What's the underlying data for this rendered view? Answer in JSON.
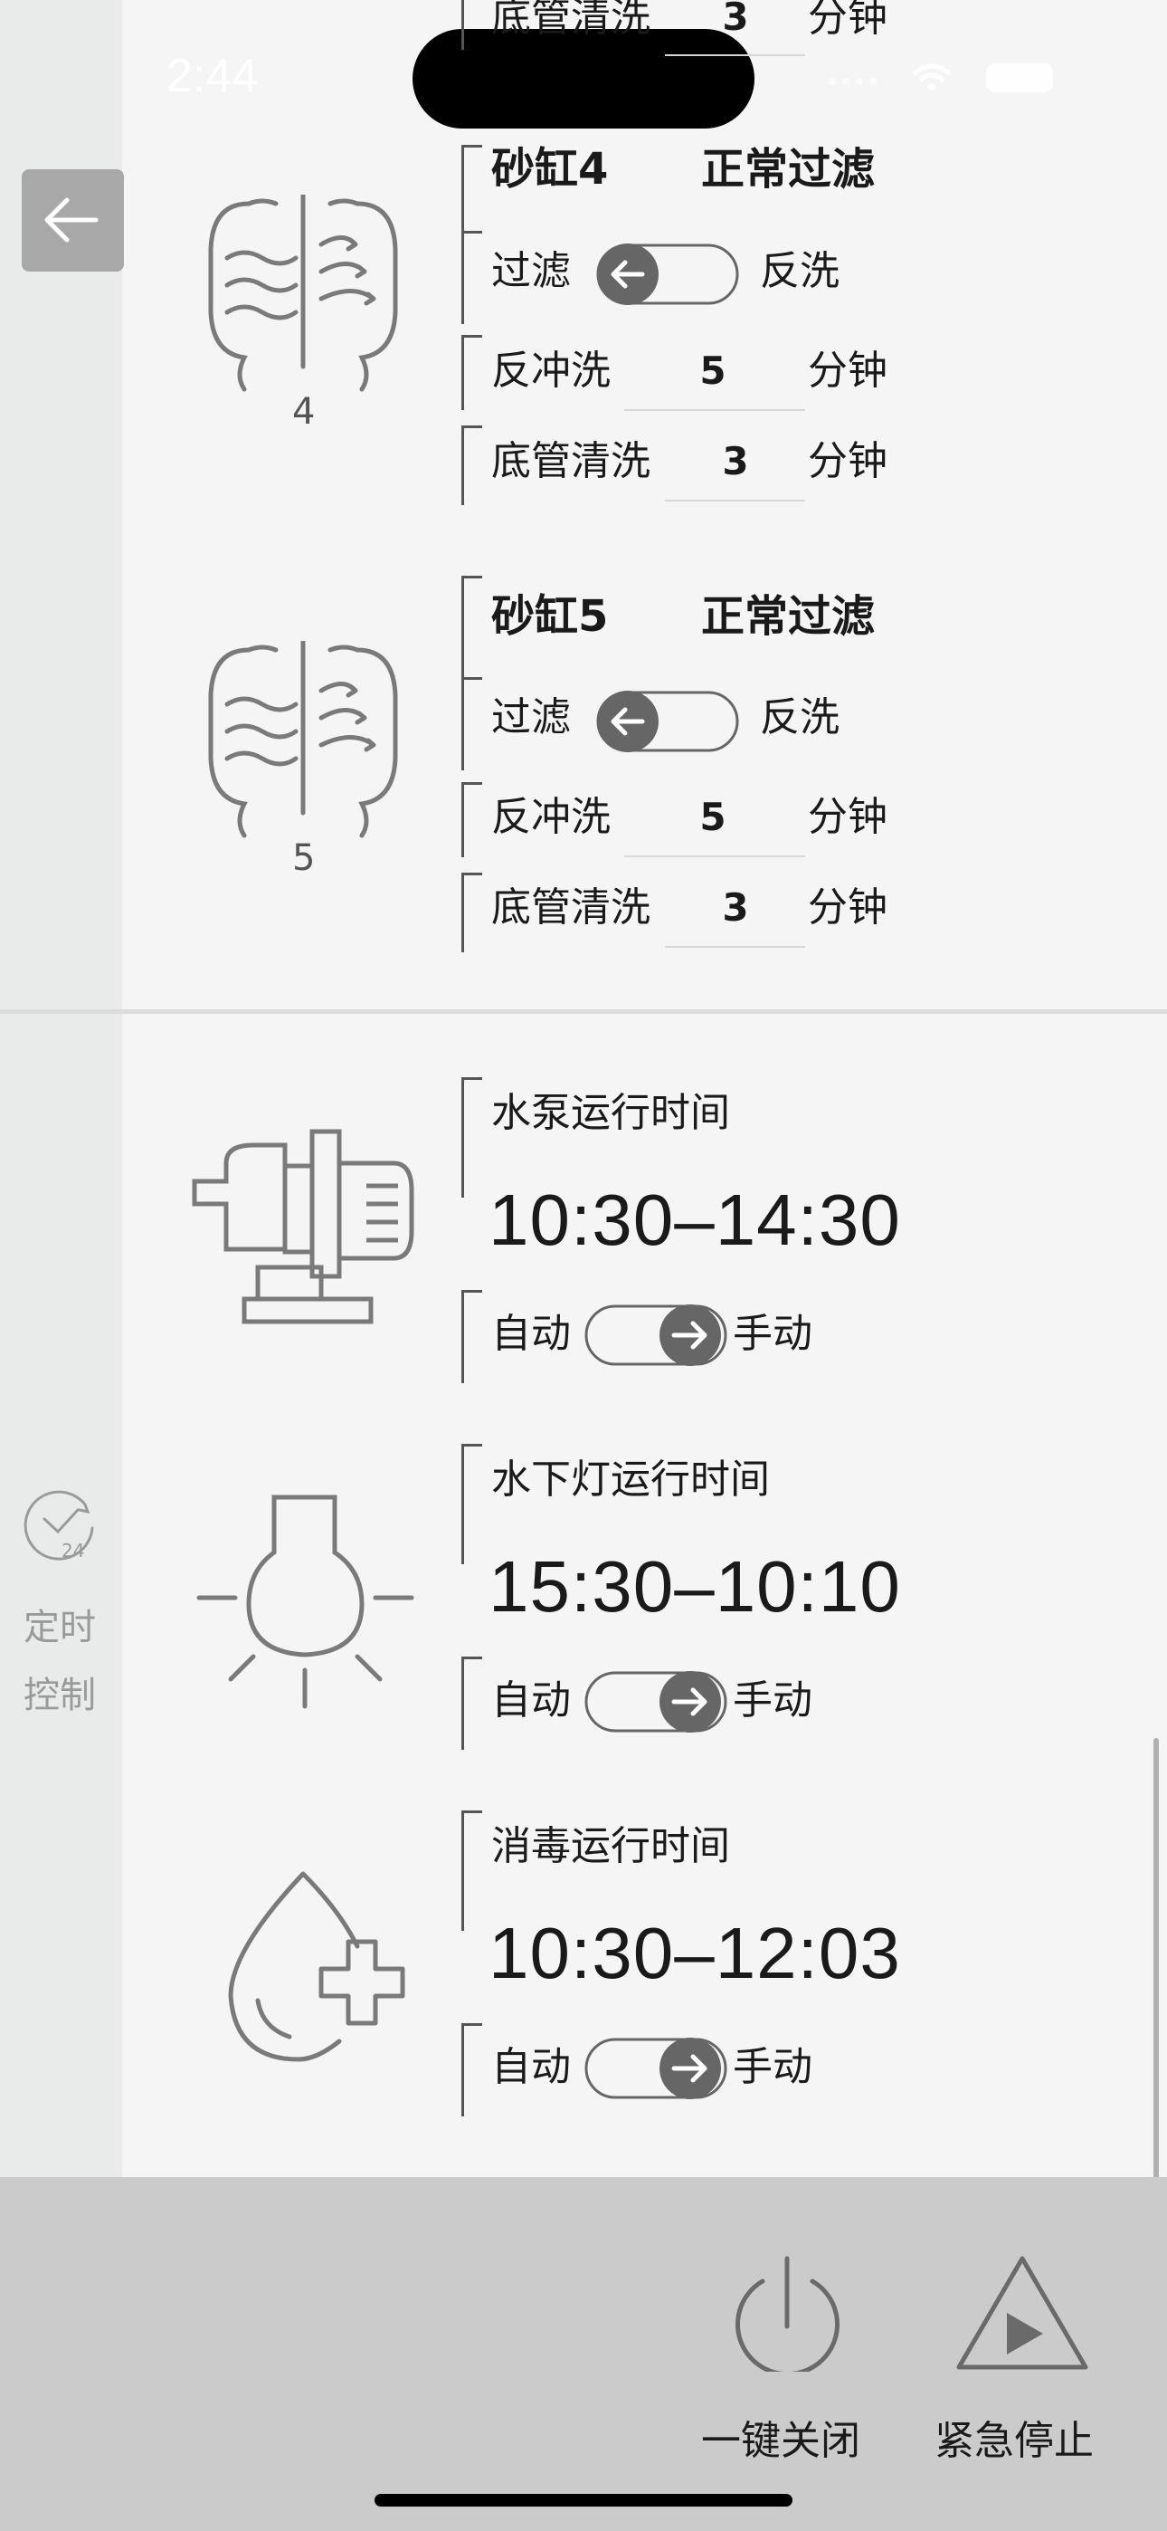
{
  "status_bar": {
    "time": "2:44"
  },
  "sand_tanks": [
    {
      "number": "4",
      "title": "砂缸4",
      "status": "正常过滤",
      "toggle_left": "过滤",
      "toggle_right": "反洗",
      "toggle_position": "left",
      "backwash_label": "反冲洗",
      "backwash_value": "5",
      "unit": "分钟",
      "bottom_clean_label": "底管清洗",
      "bottom_clean_value": "3"
    },
    {
      "number": "5",
      "title": "砂缸5",
      "status": "正常过滤",
      "toggle_left": "过滤",
      "toggle_right": "反洗",
      "toggle_position": "left",
      "backwash_label": "反冲洗",
      "backwash_value": "5",
      "unit": "分钟",
      "bottom_clean_label": "底管清洗",
      "bottom_clean_value": "3"
    }
  ],
  "partial_row": {
    "label": "底管清洗",
    "value": "3",
    "unit": "分钟"
  },
  "timers": [
    {
      "label": "水泵运行时间",
      "range": "10:30–14:30",
      "toggle_left": "自动",
      "toggle_right": "手动",
      "toggle_position": "right",
      "icon": "pump-icon"
    },
    {
      "label": "水下灯运行时间",
      "range": "15:30–10:10",
      "toggle_left": "自动",
      "toggle_right": "手动",
      "toggle_position": "right",
      "icon": "light-bulb-icon"
    },
    {
      "label": "消毒运行时间",
      "range": "10:30–12:03",
      "toggle_left": "自动",
      "toggle_right": "手动",
      "toggle_position": "right",
      "icon": "disinfect-drop-icon"
    }
  ],
  "sidebar": {
    "timer_badge": "24",
    "label_line1": "定时",
    "label_line2": "控制"
  },
  "bottom": {
    "power_off_label": "一键关闭",
    "emergency_stop_label": "紧急停止"
  },
  "colors": {
    "toggle_knob": "#666666",
    "icon_stroke": "#7a7a7a",
    "bottom_bar": "#cbcbcb"
  }
}
